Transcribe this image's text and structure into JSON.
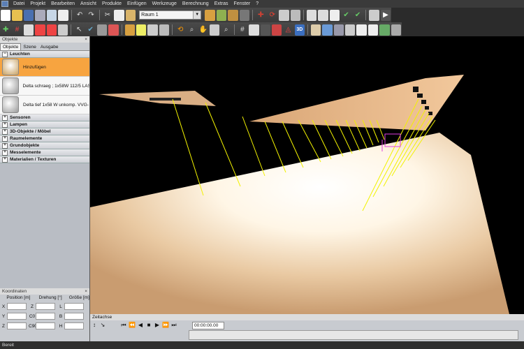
{
  "menu": [
    "Datei",
    "Projekt",
    "Bearbeiten",
    "Ansicht",
    "Produkte",
    "Einfügen",
    "Werkzeuge",
    "Berechnung",
    "Extras",
    "Fenster",
    "?"
  ],
  "toolbar": {
    "room": "Raum 1"
  },
  "objects_panel": {
    "title": "Objekte",
    "tabs": [
      "Objekte",
      "Szene",
      "Ausgabe"
    ],
    "group_leuchten": "Leuchten",
    "items": [
      "Hinzufügen",
      "Delta schraeg ; 1x58W 112/5 LAS",
      "Delta tief 1x58 W unkomp. VVG-"
    ],
    "categories": [
      "Sensoren",
      "Lampen",
      "3D-Objekte / Möbel",
      "Raumelemente",
      "Grundobjekte",
      "Messelemente",
      "Materialien / Texturen"
    ]
  },
  "coordinates_panel": {
    "title": "Koordinaten",
    "headers": {
      "position": "Position [m]",
      "rotation": "Drehung [°]",
      "size": "Größe [m]"
    },
    "rows": [
      {
        "a": "X",
        "b": "Z",
        "c": "L"
      },
      {
        "a": "Y",
        "b": "C0",
        "c": "B"
      },
      {
        "a": "Z",
        "b": "C90",
        "c": "H"
      }
    ]
  },
  "timeline": {
    "title": "Zeitachse",
    "time": "00:00:00.00"
  },
  "status": "Bereit",
  "colors": {
    "accent": "#f7a440",
    "beam": "#f2f200"
  }
}
